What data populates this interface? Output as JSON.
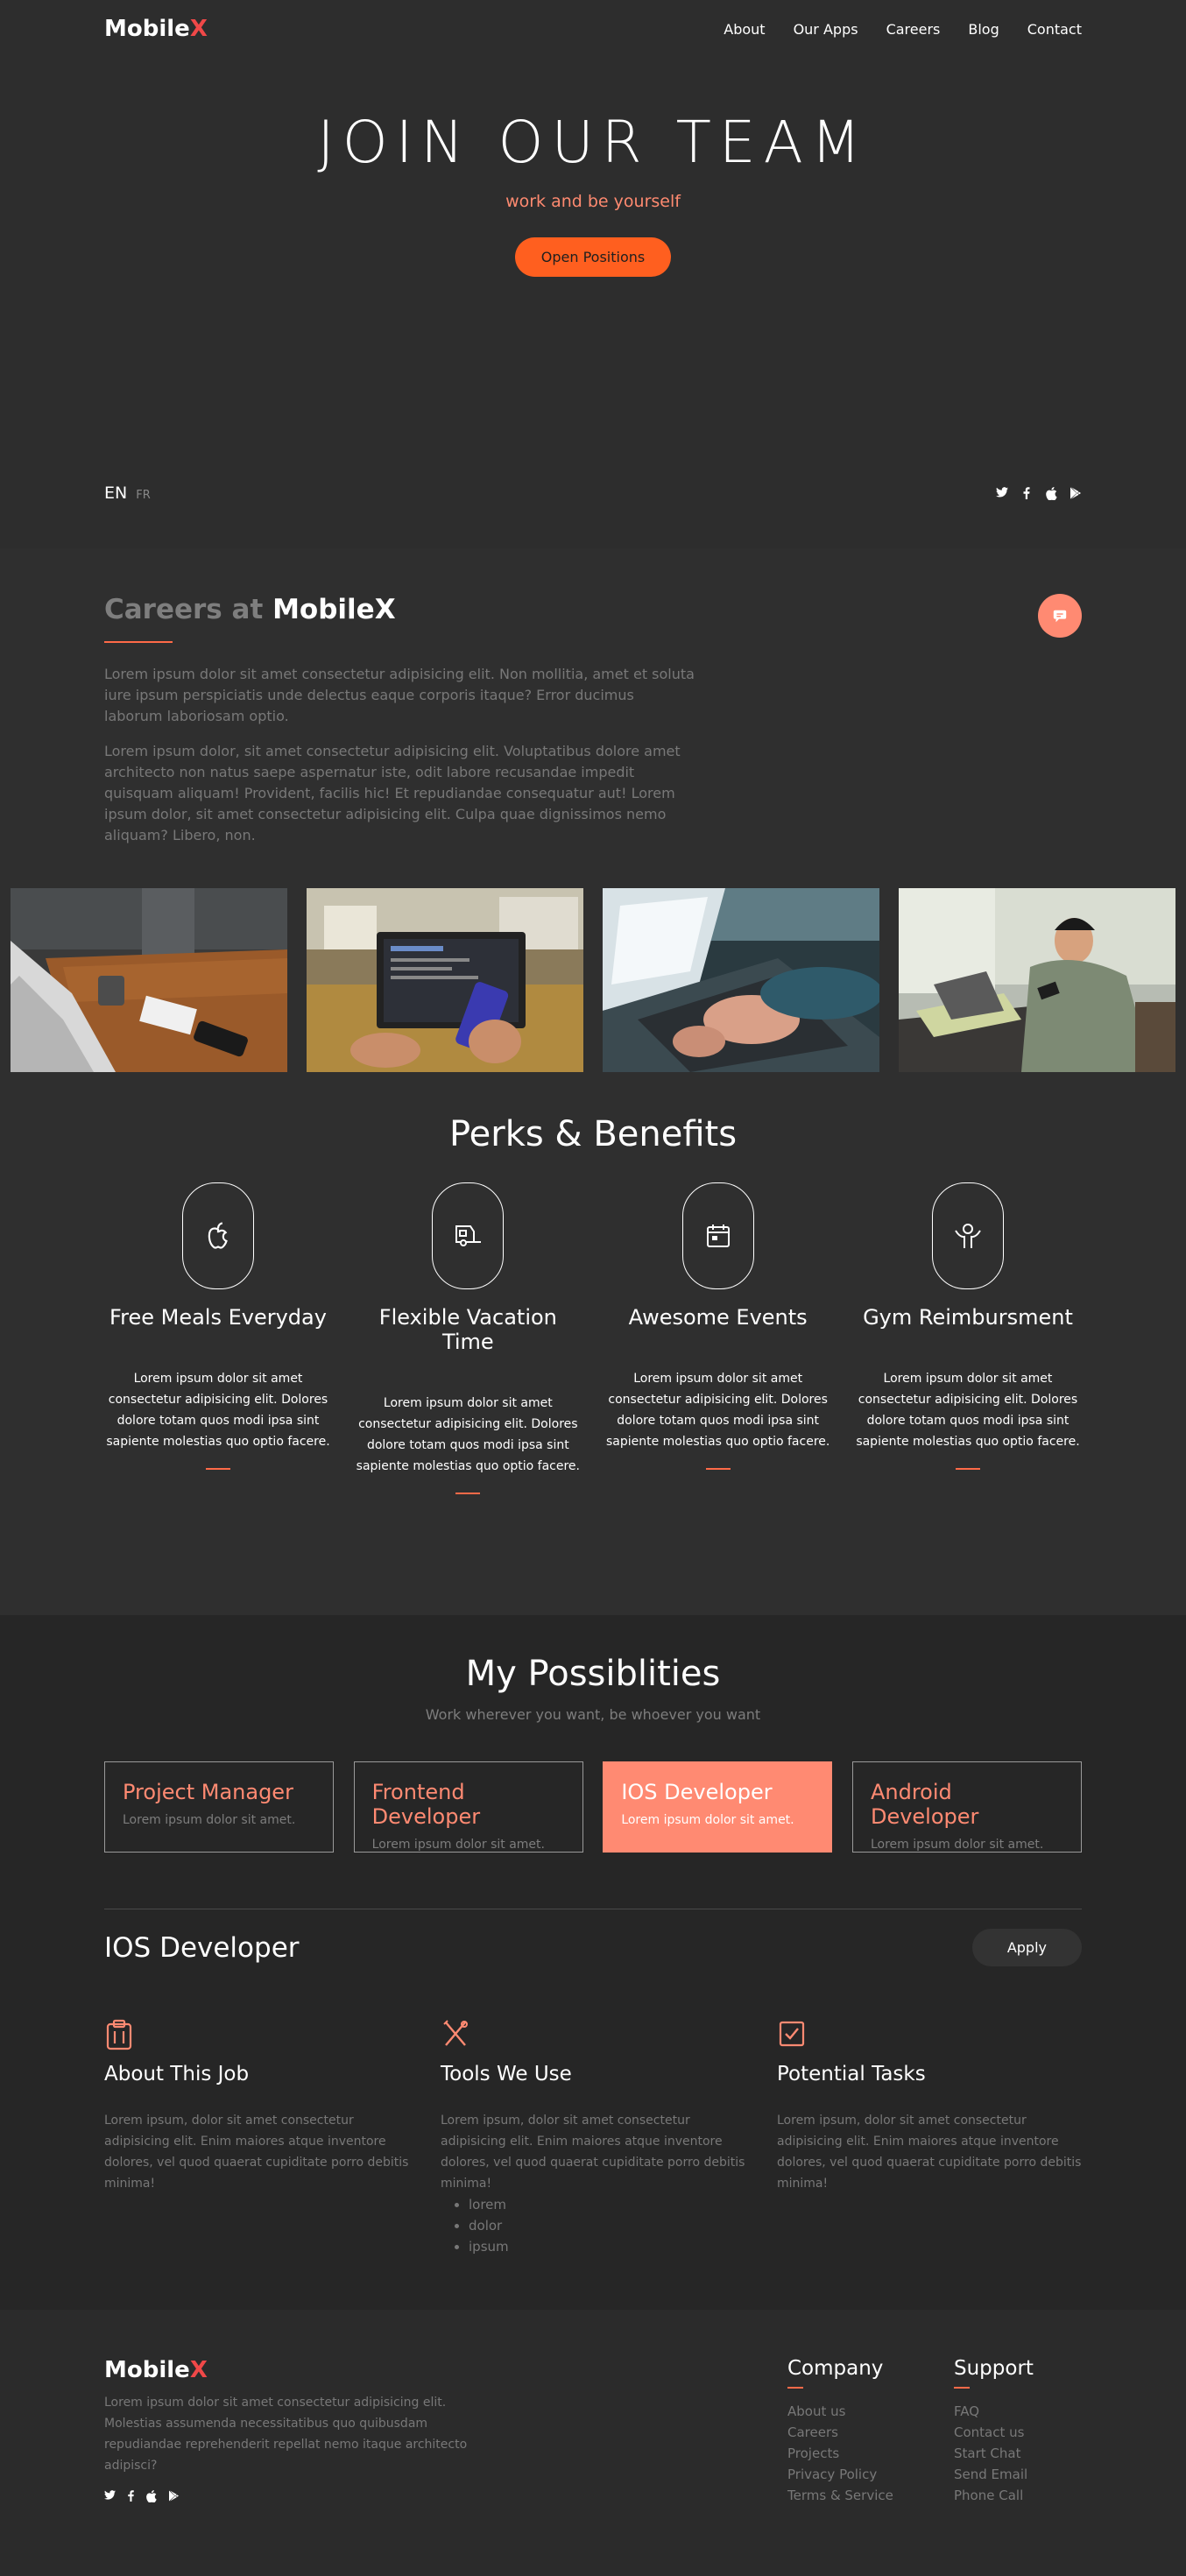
{
  "brand": {
    "name": "Mobile",
    "x": "X"
  },
  "nav": [
    "About",
    "Our Apps",
    "Careers",
    "Blog",
    "Contact"
  ],
  "hero": {
    "title": "JOIN OUR TEAM",
    "subtitle": "work and be yourself",
    "button": "Open Positions",
    "lang_active": "EN",
    "lang_other": "FR"
  },
  "careers": {
    "title_dim": "Careers at",
    "title_brand": "MobileX",
    "p1": "Lorem ipsum dolor sit amet consectetur adipisicing elit. Non mollitia, amet et soluta iure ipsum perspiciatis unde delectus eaque corporis itaque? Error ducimus laborum laboriosam optio.",
    "p2": "Lorem ipsum dolor, sit amet consectetur adipisicing elit. Voluptatibus dolore amet architecto non natus saepe aspernatur iste, odit labore recusandae impedit quisquam aliquam! Provident, facilis hic! Et repudiandae consequatur aut! Lorem ipsum dolor, sit amet consectetur adipisicing elit. Culpa quae dignissimos nemo aliquam? Libero, non."
  },
  "perks": {
    "title": "Perks & Benefits",
    "items": [
      {
        "title": "Free Meals Everyday",
        "text": "Lorem ipsum dolor sit amet consectetur adipisicing elit. Dolores dolore totam quos modi ipsa sint sapiente molestias quo optio facere.",
        "icon": "apple-icon"
      },
      {
        "title": "Flexible Vacation Time",
        "text": "Lorem ipsum dolor sit amet consectetur adipisicing elit. Dolores dolore totam quos modi ipsa sint sapiente molestias quo optio facere.",
        "icon": "camper-icon"
      },
      {
        "title": "Awesome Events",
        "text": "Lorem ipsum dolor sit amet consectetur adipisicing elit. Dolores dolore totam quos modi ipsa sint sapiente molestias quo optio facere.",
        "icon": "calendar-icon"
      },
      {
        "title": "Gym Reimbursment",
        "text": "Lorem ipsum dolor sit amet consectetur adipisicing elit. Dolores dolore totam quos modi ipsa sint sapiente molestias quo optio facere.",
        "icon": "person-icon"
      }
    ]
  },
  "possibilities": {
    "title": "My Possiblities",
    "subtitle": "Work wherever you want, be whoever you want",
    "roles": [
      {
        "title": "Project Manager",
        "desc": "Lorem ipsum dolor sit amet."
      },
      {
        "title": "Frontend Developer",
        "desc": "Lorem ipsum dolor sit amet."
      },
      {
        "title": "IOS Developer",
        "desc": "Lorem ipsum dolor sit amet."
      },
      {
        "title": "Android Developer",
        "desc": "Lorem ipsum dolor sit amet."
      }
    ],
    "active_role": "IOS Developer"
  },
  "job": {
    "title": "IOS Developer",
    "apply": "Apply",
    "cols": [
      {
        "title": "About This Job",
        "text": "Lorem ipsum, dolor sit amet consectetur adipisicing elit. Enim maiores atque inventore dolores, vel quod quaerat cupiditate porro debitis minima!"
      },
      {
        "title": "Tools We Use",
        "text": "Lorem ipsum, dolor sit amet consectetur adipisicing elit. Enim maiores atque inventore dolores, vel quod quaerat cupiditate porro debitis minima!",
        "list": [
          "lorem",
          "dolor",
          "ipsum"
        ]
      },
      {
        "title": "Potential Tasks",
        "text": "Lorem ipsum, dolor sit amet consectetur adipisicing elit. Enim maiores atque inventore dolores, vel quod quaerat cupiditate porro debitis minima!"
      }
    ]
  },
  "footer": {
    "about": "Lorem ipsum dolor sit amet consectetur adipisicing elit. Molestias assumenda necessitatibus quo quibusdam repudiandae reprehenderit repellat nemo itaque architecto adipisci?",
    "company_title": "Company",
    "company_links": [
      "About us",
      "Careers",
      "Projects",
      "Privacy Policy",
      "Terms & Service"
    ],
    "support_title": "Support",
    "support_links": [
      "FAQ",
      "Contact us",
      "Start Chat",
      "Send Email",
      "Phone Call"
    ]
  },
  "colors": {
    "accent": "#ff5f1f",
    "salmon": "#ff8a72",
    "brand_x": "#f04848"
  }
}
